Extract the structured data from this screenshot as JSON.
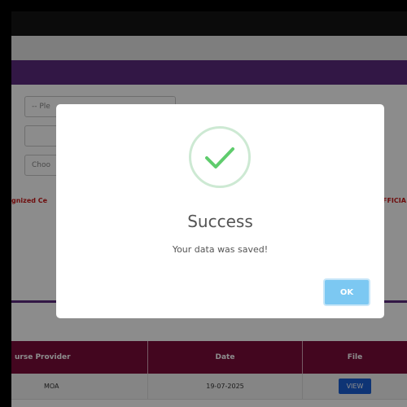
{
  "form": {
    "select_placeholder": "-- Ple",
    "file_button": "Choo",
    "red_left": "gnized Ce",
    "red_right": "FFICIA"
  },
  "table": {
    "headers": [
      "urse Provider",
      "Date",
      "File"
    ],
    "rows": [
      {
        "provider": "MOA",
        "date": "19-07-2025",
        "file_label": "VIEW"
      }
    ]
  },
  "modal": {
    "icon": "checkmark-icon",
    "title": "Success",
    "message": "Your data was saved!",
    "ok_label": "OK"
  },
  "colors": {
    "brand_purple": "#5b2a7f",
    "table_header": "#7a0b3a",
    "success_green": "#5fcc6d",
    "ok_button": "#7cc8f2",
    "view_button": "#1b5fd6"
  }
}
